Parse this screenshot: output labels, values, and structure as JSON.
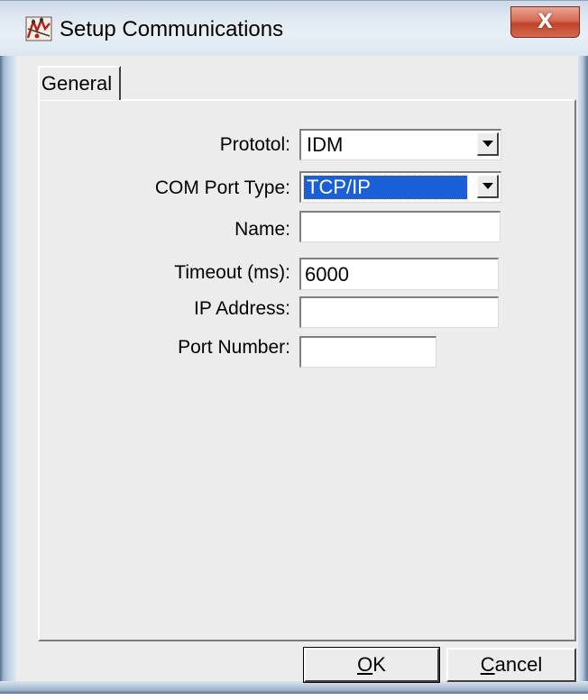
{
  "window": {
    "title": "Setup Communications",
    "close_glyph": "X"
  },
  "tabs": [
    {
      "label": "General",
      "active": true
    }
  ],
  "form": {
    "protocol": {
      "label": "Prototol:",
      "value": "IDM"
    },
    "com_port_type": {
      "label": "COM Port Type:",
      "value": "TCP/IP"
    },
    "name": {
      "label": "Name:",
      "value": ""
    },
    "timeout": {
      "label": "Timeout (ms):",
      "value": "6000"
    },
    "ip_address": {
      "label": "IP Address:",
      "value": ""
    },
    "port_number": {
      "label": "Port Number:",
      "value": ""
    }
  },
  "buttons": {
    "ok": {
      "mnemonic": "O",
      "rest": "K"
    },
    "cancel": {
      "mnemonic": "C",
      "rest": "ancel"
    }
  },
  "icons": {
    "app": "setup-communications-icon",
    "close": "close-icon",
    "dropdown": "chevron-down-icon"
  },
  "colors": {
    "selection": "#1a5fd8",
    "close_button": "#c8472f",
    "dialog_face": "#ececec"
  }
}
